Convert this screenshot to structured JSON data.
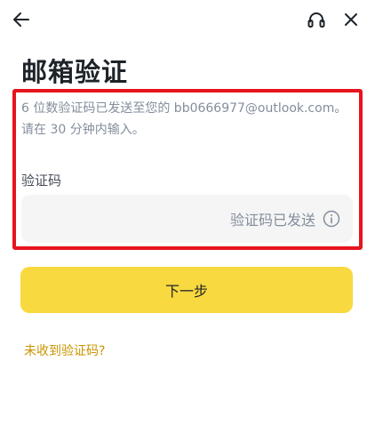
{
  "header": {
    "back_icon": "arrow-left-icon",
    "support_icon": "headset-icon",
    "close_icon": "close-icon"
  },
  "title": "邮箱验证",
  "description": "6 位数验证码已发送至您的 bb0666977@outlook.com。请在 30 分钟内输入。",
  "code_field": {
    "label": "验证码",
    "value": "",
    "status": "验证码已发送",
    "info_icon": "info-circle-icon"
  },
  "next_button": {
    "label": "下一步"
  },
  "resend_link": {
    "label": "未收到验证码?"
  },
  "colors": {
    "accent": "#f8d93f",
    "link": "#c99400",
    "highlight_border": "#e6141e",
    "field_bg": "#f5f5f5",
    "muted_text": "#848e9c"
  }
}
